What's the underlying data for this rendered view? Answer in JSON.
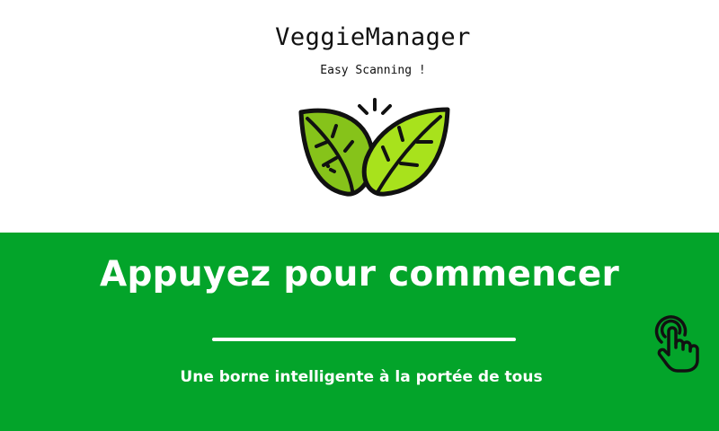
{
  "header": {
    "app_title": "VeggieManager",
    "subtitle": "Easy Scanning !",
    "logo_icon": "leaves-icon"
  },
  "banner": {
    "title": "Appuyez pour commencer",
    "subtitle": "Une borne intelligente à la portée de tous",
    "tap_icon": "tap-hand-icon"
  },
  "colors": {
    "banner_green": "#03a42a",
    "leaf_light": "#a8e21c",
    "leaf_dark": "#86c31a",
    "outline": "#111111"
  }
}
